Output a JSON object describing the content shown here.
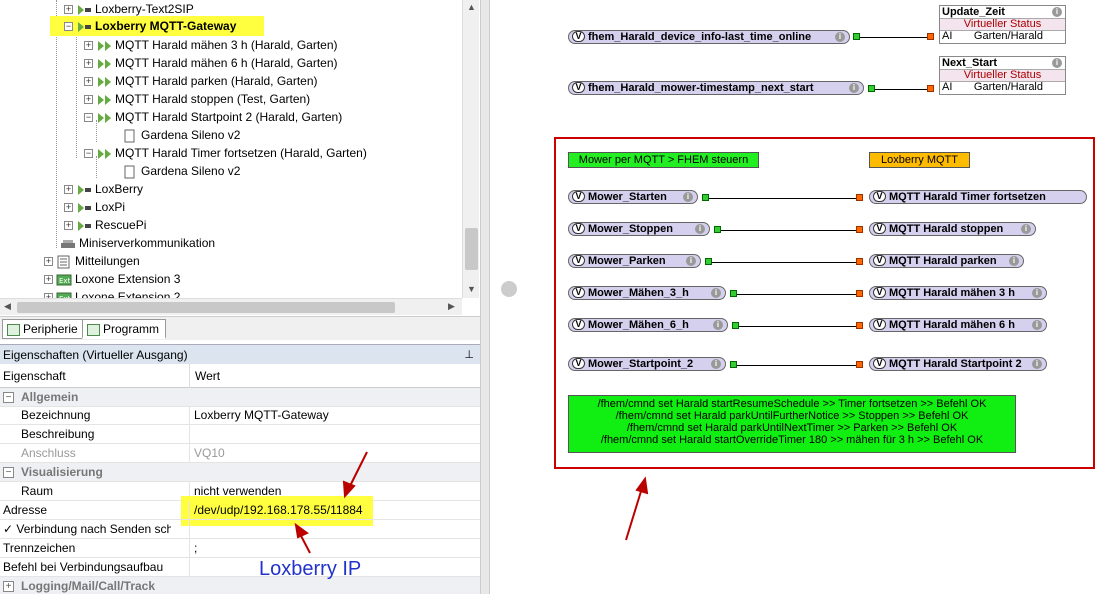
{
  "tree": {
    "items": [
      {
        "label": "Loxberry-Text2SIP",
        "indent": 1
      },
      {
        "label": "Loxberry MQTT-Gateway",
        "indent": 1,
        "selected": true
      },
      {
        "label": "MQTT Harald mähen 3 h (Harald, Garten)",
        "indent": 2
      },
      {
        "label": "MQTT Harald mähen 6 h (Harald, Garten)",
        "indent": 2
      },
      {
        "label": "MQTT Harald parken (Harald, Garten)",
        "indent": 2
      },
      {
        "label": "MQTT Harald stoppen (Test, Garten)",
        "indent": 2
      },
      {
        "label": "MQTT Harald Startpoint 2 (Harald, Garten)",
        "indent": 2
      },
      {
        "label": "Gardena Sileno v2",
        "indent": 3
      },
      {
        "label": "MQTT Harald Timer fortsetzen (Harald, Garten)",
        "indent": 2
      },
      {
        "label": "Gardena Sileno v2",
        "indent": 3
      },
      {
        "label": "LoxBerry",
        "indent": 1
      },
      {
        "label": "LoxPi",
        "indent": 1
      },
      {
        "label": "RescuePi",
        "indent": 1
      },
      {
        "label": "Miniserverkommunikation",
        "indent": 0
      },
      {
        "label": "Mitteilungen",
        "indent": -1
      },
      {
        "label": "Loxone Extension 3",
        "indent": -1
      },
      {
        "label": "Loxone Extension 2",
        "indent": -1
      }
    ]
  },
  "tabs": {
    "peripherie": "Peripherie",
    "programm": "Programm"
  },
  "props": {
    "title": "Eigenschaften (Virtueller Ausgang)",
    "col_key": "Eigenschaft",
    "col_val": "Wert",
    "cat_allgemein": "Allgemein",
    "bezeichnung_k": "Bezeichnung",
    "bezeichnung_v": "Loxberry MQTT-Gateway",
    "beschreibung_k": "Beschreibung",
    "anschluss_k": "Anschluss",
    "anschluss_v": "VQ10",
    "cat_visual": "Visualisierung",
    "raum_k": "Raum",
    "raum_v": "nicht verwenden",
    "adresse_k": "Adresse",
    "adresse_v": "/dev/udp/192.168.178.55/11884",
    "verbindung_k": "Verbindung nach Senden sch...",
    "trenn_k": "Trennzeichen",
    "trenn_v": ";",
    "befehl_k": "Befehl bei Verbindungsaufbau",
    "cat_logging": "Logging/Mail/Call/Track"
  },
  "annotation": {
    "loxberry_ip": "Loxberry IP"
  },
  "canvas": {
    "top_inputs": [
      {
        "label": "fhem_Harald_device_info-last_time_online"
      },
      {
        "label": "fhem_Harald_mower-timestamp_next_start"
      }
    ],
    "status_blocks": [
      {
        "title": "Update_Zeit",
        "sub": "Virtueller Status",
        "ai": "AI",
        "value": "Garten/Harald"
      },
      {
        "title": "Next_Start",
        "sub": "Virtueller Status",
        "ai": "AI",
        "value": "Garten/Harald"
      }
    ],
    "label_green": "Mower per MQTT > FHEM steuern",
    "label_orange": "Loxberry MQTT",
    "rows": [
      {
        "in": "Mower_Starten",
        "out": "MQTT Harald Timer fortsetzen"
      },
      {
        "in": "Mower_Stoppen",
        "out": "MQTT Harald stoppen"
      },
      {
        "in": "Mower_Parken",
        "out": "MQTT Harald parken"
      },
      {
        "in": "Mower_Mähen_3_h",
        "out": "MQTT Harald mähen 3 h"
      },
      {
        "in": "Mower_Mähen_6_h",
        "out": "MQTT Harald mähen 6 h"
      },
      {
        "in": "Mower_Startpoint_2",
        "out": "MQTT Harald Startpoint 2"
      }
    ],
    "comment_lines": [
      "/fhem/cmnd set Harald startResumeSchedule >> Timer fortsetzen  >> Befehl OK",
      "/fhem/cmnd set Harald parkUntilFurtherNotice >> Stoppen  >> Befehl OK",
      "/fhem/cmnd set Harald parkUntilNextTimer >> Parken  >> Befehl OK",
      "/fhem/cmnd set Harald startOverrideTimer 180 >> mähen für 3 h >> Befehl OK"
    ],
    "colors": {
      "frame": "#cc0000",
      "comment_bg": "#11ee11",
      "label_orange_bg": "#ffbb00",
      "label_green_bg": "#22ee22"
    }
  }
}
